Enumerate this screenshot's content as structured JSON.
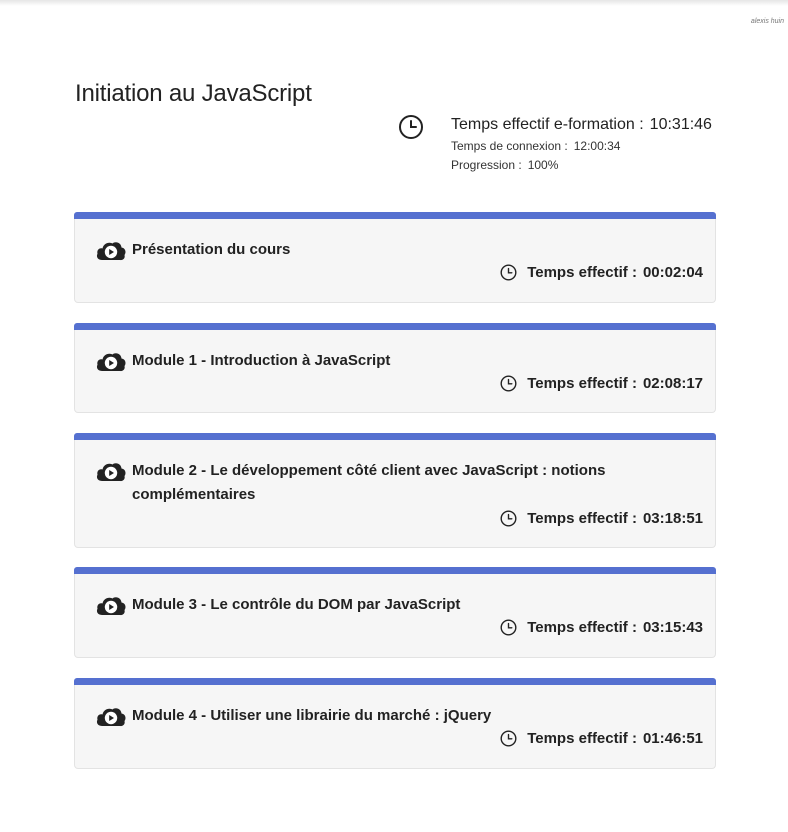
{
  "user": {
    "name": "alexis huin"
  },
  "course": {
    "title": "Initiation au JavaScript"
  },
  "stats": {
    "effective_label": "Temps effectif e-formation :",
    "effective_value": "10:31:46",
    "connection_label": "Temps de connexion :",
    "connection_value": "12:00:34",
    "progress_label": "Progression :",
    "progress_value": "100%"
  },
  "accent_color": "#5570d0",
  "module_icon": "cloud-play-icon",
  "modules": [
    {
      "title": "Présentation du cours",
      "time_label": "Temps effectif :",
      "time_value": "00:02:04"
    },
    {
      "title": "Module 1 - Introduction à JavaScript",
      "time_label": "Temps effectif :",
      "time_value": "02:08:17"
    },
    {
      "title": "Module 2 - Le développement côté client avec JavaScript : notions complémentaires",
      "time_label": "Temps effectif :",
      "time_value": "03:18:51"
    },
    {
      "title": "Module 3 - Le contrôle du DOM par JavaScript",
      "time_label": "Temps effectif :",
      "time_value": "03:15:43"
    },
    {
      "title": "Module 4 - Utiliser une librairie du marché : jQuery",
      "time_label": "Temps effectif :",
      "time_value": "01:46:51"
    }
  ]
}
